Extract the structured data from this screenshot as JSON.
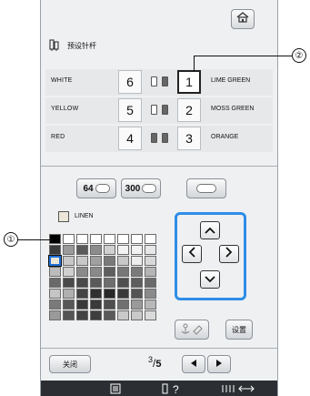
{
  "title": "预设针杆",
  "spool_rows": [
    {
      "left_name": "WHITE",
      "bar_number": "6",
      "right_number": "1",
      "right_name": "LIME GREEN"
    },
    {
      "left_name": "YELLOW",
      "bar_number": "5",
      "right_number": "2",
      "right_name": "MOSS GREEN"
    },
    {
      "left_name": "RED",
      "bar_number": "4",
      "right_number": "3",
      "right_name": "ORANGE"
    }
  ],
  "palette_buttons": {
    "palette_64": "64",
    "palette_300": "300"
  },
  "current_color": {
    "name": "LINEN",
    "swatch": "#ece6d8"
  },
  "color_grid": [
    "#000000",
    "#ffffff",
    "#ffffff",
    "#ffffff",
    "#ffffff",
    "#ffffff",
    "#ffffff",
    "#ffffff",
    "#3b3b3b",
    "#9a9a9a",
    "#5a5a5a",
    "#8c8c8c",
    "#d0d0d0",
    "#f2f2f2",
    "#f2f2f2",
    "#e8e8e8",
    "#ece6d8",
    "#c8c8c8",
    "#c8c8c8",
    "#a0a0a0",
    "#7a7a7a",
    "#c8c8c8",
    "#ededed",
    "#d8d8d8",
    "#bcbcbc",
    "#cfcfcf",
    "#8a8a8a",
    "#8a8a8a",
    "#5f5f5f",
    "#777777",
    "#7b7b7b",
    "#b5b5b5",
    "#6a6a6a",
    "#4a4a4a",
    "#4a4a4a",
    "#5a5a5a",
    "#6e6e6e",
    "#4f4f4f",
    "#5e5e5e",
    "#6a6a6a",
    "#c5c5c5",
    "#b0b0b0",
    "#444444",
    "#303030",
    "#282828",
    "#3a3a3a",
    "#545454",
    "#8b8b8b",
    "#7a7a7a",
    "#575757",
    "#3a3a3a",
    "#3a3a3a",
    "#4e4e4e",
    "#707070",
    "#9a9a9a",
    "#b8b8b8",
    "#9a9a9a",
    "#545454",
    "#424242",
    "#3e3e3e",
    "#5a5a5a",
    "#c9c9c9",
    "#c9c9c9",
    "#dadada"
  ],
  "settings_label": "设置",
  "close_label": "关闭",
  "page": {
    "current": "3",
    "total": "5"
  },
  "callouts": {
    "one": "①",
    "two": "②"
  },
  "colors": {
    "accent_blue": "#2f8de8",
    "status_bar": "#2b2f33"
  }
}
